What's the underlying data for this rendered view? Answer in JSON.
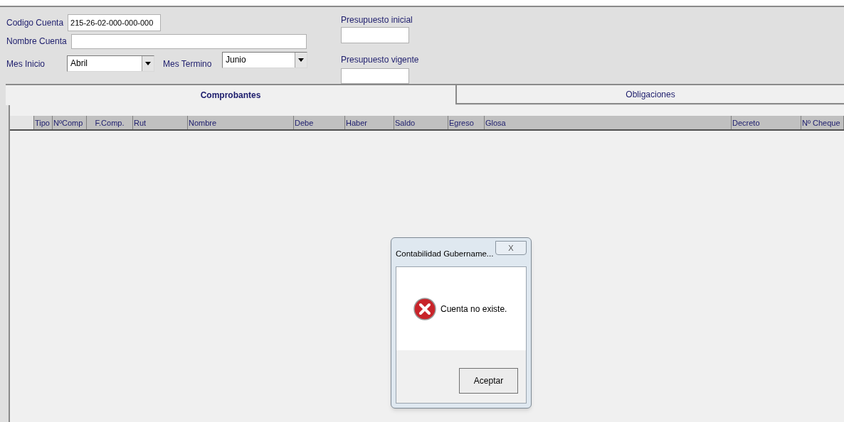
{
  "form": {
    "codigo_cuenta": {
      "label": "Codigo Cuenta",
      "value": "215-26-02-000-000-000"
    },
    "nombre_cuenta": {
      "label": "Nombre Cuenta"
    },
    "mes_inicio": {
      "label": "Mes Inicio",
      "value": "Abril"
    },
    "mes_termino": {
      "label": "Mes Termino",
      "value": "Junio"
    },
    "presupuesto_inicial": {
      "label": "Presupuesto inicial"
    },
    "presupuesto_vigente": {
      "label": "Presupuesto vigente"
    }
  },
  "tabs": [
    {
      "label": "Comprobantes",
      "selected": true
    },
    {
      "label": "Obligaciones",
      "selected": false
    }
  ],
  "table": {
    "columns": [
      "Tipo",
      "NºComp",
      "F.Comp.",
      "Rut",
      "Nombre",
      "Debe",
      "Haber",
      "Saldo",
      "Egreso",
      "Glosa",
      "Decreto",
      "Nº Cheque"
    ]
  },
  "dialog": {
    "title": "Contabilidad Gubername...",
    "close": "X",
    "message": "Cuenta no existe.",
    "buttons": [
      "Aceptar"
    ]
  }
}
